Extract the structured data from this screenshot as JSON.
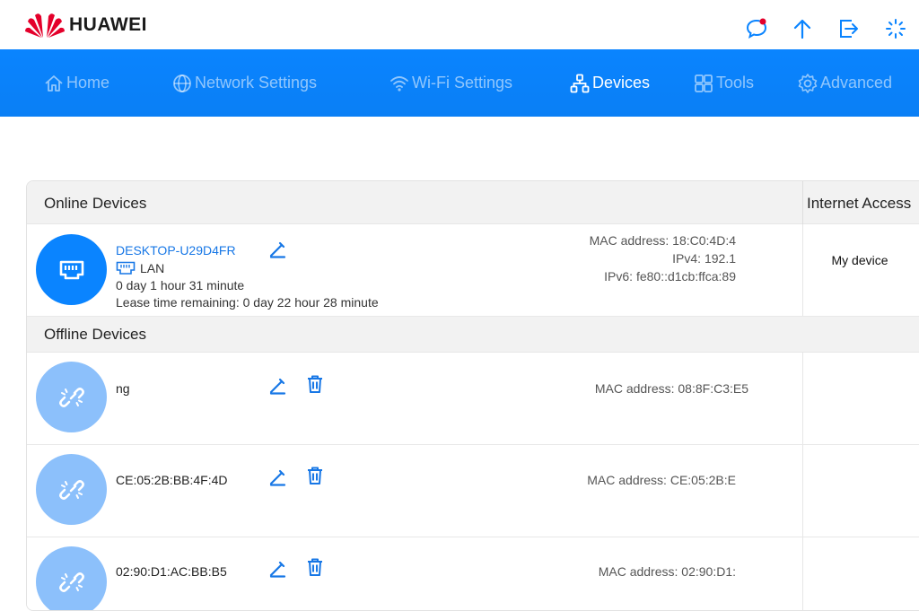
{
  "brand": {
    "name": "HUAWEI",
    "color": "#e4002b"
  },
  "accent": "#0a84ff",
  "top_icons": [
    "chat-icon",
    "upload-icon",
    "logout-icon",
    "loading-icon"
  ],
  "nav": {
    "items": [
      {
        "label": "Home",
        "icon": "home-icon",
        "active": false
      },
      {
        "label": "Network Settings",
        "icon": "globe-icon",
        "active": false
      },
      {
        "label": "Wi-Fi Settings",
        "icon": "wifi-icon",
        "active": false
      },
      {
        "label": "Devices",
        "icon": "devices-icon",
        "active": true
      },
      {
        "label": "Tools",
        "icon": "tools-icon",
        "active": false
      },
      {
        "label": "Advanced",
        "icon": "gear-icon",
        "active": false
      }
    ]
  },
  "table": {
    "online_title": "Online Devices",
    "access_header": "Internet Access",
    "offline_title": "Offline Devices"
  },
  "online": [
    {
      "name": "DESKTOP-U29D4FR",
      "connection": "LAN",
      "online_time": "0 day 1 hour 31 minute",
      "lease": "Lease time remaining: 0 day 22 hour 28 minute",
      "mac": "MAC address: 18:C0:4D:4",
      "ipv4": "IPv4: 192.1",
      "ipv6": "IPv6: fe80::d1cb:ffca:89",
      "access": "My device"
    }
  ],
  "offline": [
    {
      "name": "ng",
      "mac": "MAC address: 08:8F:C3:E5"
    },
    {
      "name": "CE:05:2B:BB:4F:4D",
      "mac": "MAC address: CE:05:2B:E"
    },
    {
      "name": "02:90:D1:AC:BB:B5",
      "mac": "MAC address: 02:90:D1:"
    }
  ]
}
